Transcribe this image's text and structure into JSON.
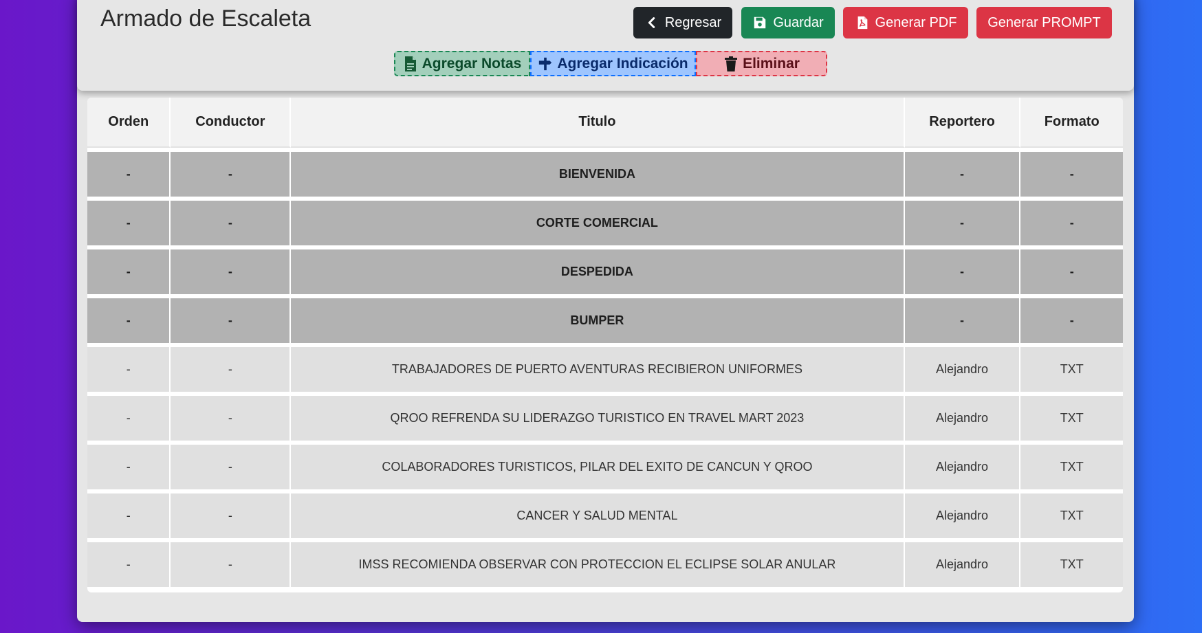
{
  "page": {
    "title": "Armado de Escaleta"
  },
  "toolbar": {
    "back_label": "Regresar",
    "save_label": "Guardar",
    "pdf_label": "Generar PDF",
    "prompt_label": "Generar PROMPT"
  },
  "tools": {
    "notes_label": "Agregar Notas",
    "indication_label": "Agregar Indicación",
    "delete_label": "Eliminar"
  },
  "colors": {
    "dark": "#212529",
    "success": "#198754",
    "danger": "#dc3545",
    "primary": "#0d6efd"
  },
  "table": {
    "headers": [
      "Orden",
      "Conductor",
      "Titulo",
      "Reportero",
      "Formato"
    ],
    "rows": [
      {
        "section": true,
        "cells": [
          "-",
          "-",
          "BIENVENIDA",
          "-",
          "-"
        ]
      },
      {
        "section": true,
        "cells": [
          "-",
          "-",
          "CORTE COMERCIAL",
          "-",
          "-"
        ]
      },
      {
        "section": true,
        "cells": [
          "-",
          "-",
          "DESPEDIDA",
          "-",
          "-"
        ]
      },
      {
        "section": true,
        "cells": [
          "-",
          "-",
          "BUMPER",
          "-",
          "-"
        ]
      },
      {
        "section": false,
        "cells": [
          "-",
          "-",
          "TRABAJADORES DE PUERTO AVENTURAS RECIBIERON UNIFORMES",
          "Alejandro",
          "TXT"
        ]
      },
      {
        "section": false,
        "cells": [
          "-",
          "-",
          "QROO REFRENDA SU LIDERAZGO TURISTICO EN TRAVEL MART 2023",
          "Alejandro",
          "TXT"
        ]
      },
      {
        "section": false,
        "cells": [
          "-",
          "-",
          "COLABORADORES TURISTICOS, PILAR DEL EXITO DE CANCUN Y QROO",
          "Alejandro",
          "TXT"
        ]
      },
      {
        "section": false,
        "cells": [
          "-",
          "-",
          "CANCER Y SALUD MENTAL",
          "Alejandro",
          "TXT"
        ]
      },
      {
        "section": false,
        "cells": [
          "-",
          "-",
          "IMSS RECOMIENDA OBSERVAR CON PROTECCION EL ECLIPSE SOLAR ANULAR",
          "Alejandro",
          "TXT"
        ]
      }
    ]
  }
}
